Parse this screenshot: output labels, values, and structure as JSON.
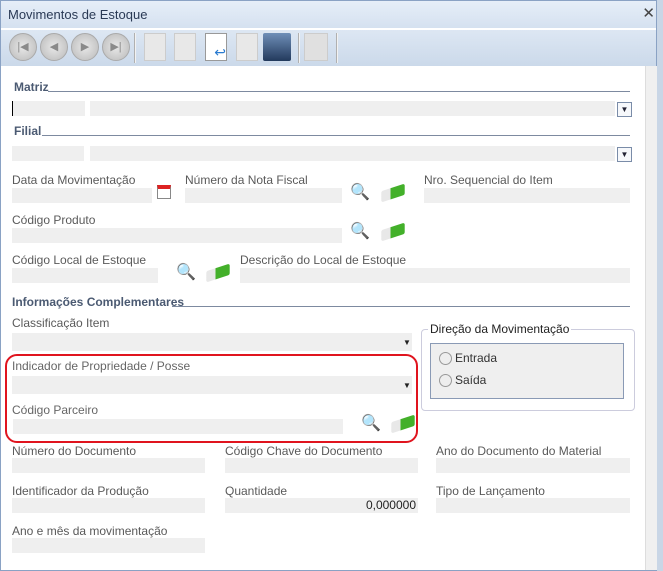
{
  "window": {
    "title": "Movimentos de Estoque"
  },
  "toolbar": {
    "buttons": [
      "first-record",
      "previous-record",
      "next-record",
      "last-record",
      "new",
      "edit",
      "undo",
      "delete",
      "save",
      "lock"
    ]
  },
  "sections": {
    "matriz": "Matriz",
    "filial": "Filial",
    "info": "Informações Complementares"
  },
  "fields": {
    "data_mov": "Data da Movimentação",
    "nota_fiscal": "Número da Nota Fiscal",
    "nro_seq": "Nro. Sequencial do Item",
    "cod_produto": "Código Produto",
    "cod_local": "Código Local de Estoque",
    "desc_local": "Descrição do Local de Estoque",
    "classificacao": "Classificação Item",
    "indicador": "Indicador de Propriedade / Posse",
    "cod_parceiro": "Código Parceiro",
    "num_doc": "Número do Documento",
    "cod_chave": "Código Chave do Documento",
    "ano_doc": "Ano do Documento do Material",
    "ident_prod": "Identificador da Produção",
    "quantidade": "Quantidade",
    "quantidade_value": "0,000000",
    "tipo_lanc": "Tipo de Lançamento",
    "ano_mes": "Ano e mês da movimentação"
  },
  "direcao": {
    "title": "Direção da Movimentação",
    "options": [
      "Entrada",
      "Saída"
    ]
  },
  "colors": {
    "highlight": "#e0141e"
  }
}
